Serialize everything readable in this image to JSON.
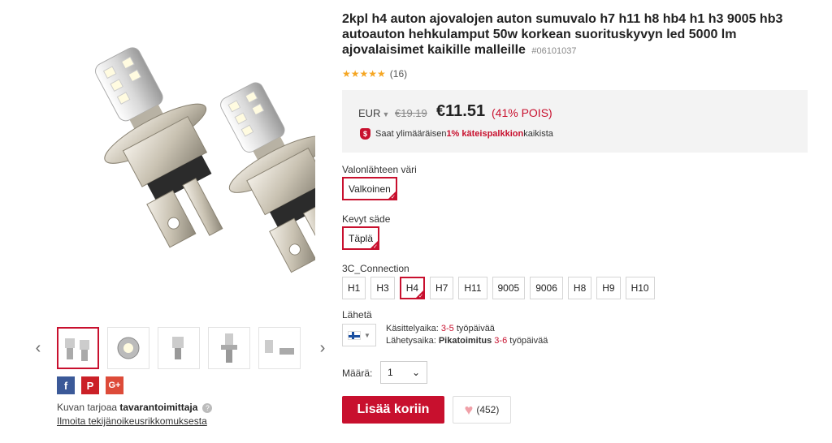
{
  "product": {
    "title": "2kpl h4 auton ajovalojen auton sumuvalo h7 h11 h8 hb4 h1 h3 9005 hb3 autoauton hehkulamput 50w korkean suorituskyvyn led 5000 lm ajovalaisimet kaikille malleille",
    "sku": "#06101037",
    "stars": "★★★★★",
    "rating_count": "(16)"
  },
  "price": {
    "currency": "EUR",
    "old": "€19.19",
    "new": "€11.51",
    "discount": "(41% POIS)",
    "cashback_prefix": "Saat ylimääräisen ",
    "cashback_highlight": "1% käteispalkkion",
    "cashback_suffix": " kaikista"
  },
  "options": {
    "color_label": "Valonlähteen väri",
    "color_value": "Valkoinen",
    "beam_label": "Kevyt säde",
    "beam_value": "Täplä",
    "connection_label": "3C_Connection",
    "connections": [
      "H1",
      "H3",
      "H4",
      "H7",
      "H11",
      "9005",
      "9006",
      "H8",
      "H9",
      "H10"
    ],
    "selected_connection": "H4"
  },
  "shipping": {
    "label": "Lähetä",
    "processing_prefix": "Käsittelyaika: ",
    "processing_range": "3-5",
    "processing_suffix": " työpäivää",
    "delivery_prefix": "Lähetysaika: ",
    "delivery_method": "Pikatoimitus",
    "delivery_range": "3-6",
    "delivery_suffix": " työpäivää"
  },
  "quantity": {
    "label": "Määrä:",
    "value": "1"
  },
  "actions": {
    "add_to_cart": "Lisää koriin",
    "wishlist_count": "(452)"
  },
  "gallery": {
    "provided_prefix": "Kuvan tarjoaa ",
    "provided_by": "tavarantoimittaja",
    "report_link": "Ilmoita tekijänoikeusrikkomuksesta"
  },
  "share": {
    "facebook": "f",
    "pinterest": "P",
    "googleplus": "G+"
  },
  "colors": {
    "accent": "#c8102e",
    "price_box_bg": "#f3f3f3"
  }
}
